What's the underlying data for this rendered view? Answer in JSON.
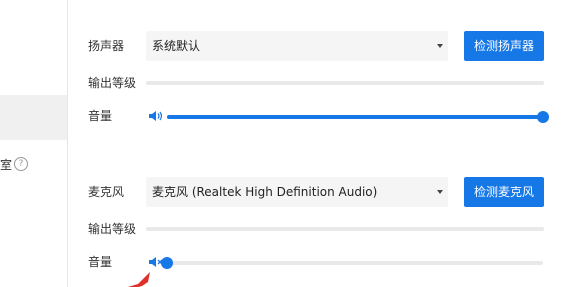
{
  "sidebar": {
    "partial_label": "室",
    "help_glyph": "?"
  },
  "speaker": {
    "label": "扬声器",
    "device_value": "系统默认",
    "test_button": "检测扬声器",
    "output_level_label": "输出等级",
    "volume_label": "音量",
    "volume_level": 1.0
  },
  "microphone": {
    "label": "麦克风",
    "device_value": "麦克风 (Realtek High Definition Audio)",
    "test_button": "检测麦克风",
    "output_level_label": "输出等级",
    "volume_label": "音量",
    "volume_level": 0.0,
    "muted": true
  },
  "colors": {
    "accent": "#1677e6",
    "arrow": "#e0302a"
  },
  "icons": {
    "speaker_volume": "volume-icon",
    "mic_volume_muted": "volume-muted-icon",
    "dropdown": "chevron-down-icon",
    "help": "help-circle-icon"
  }
}
